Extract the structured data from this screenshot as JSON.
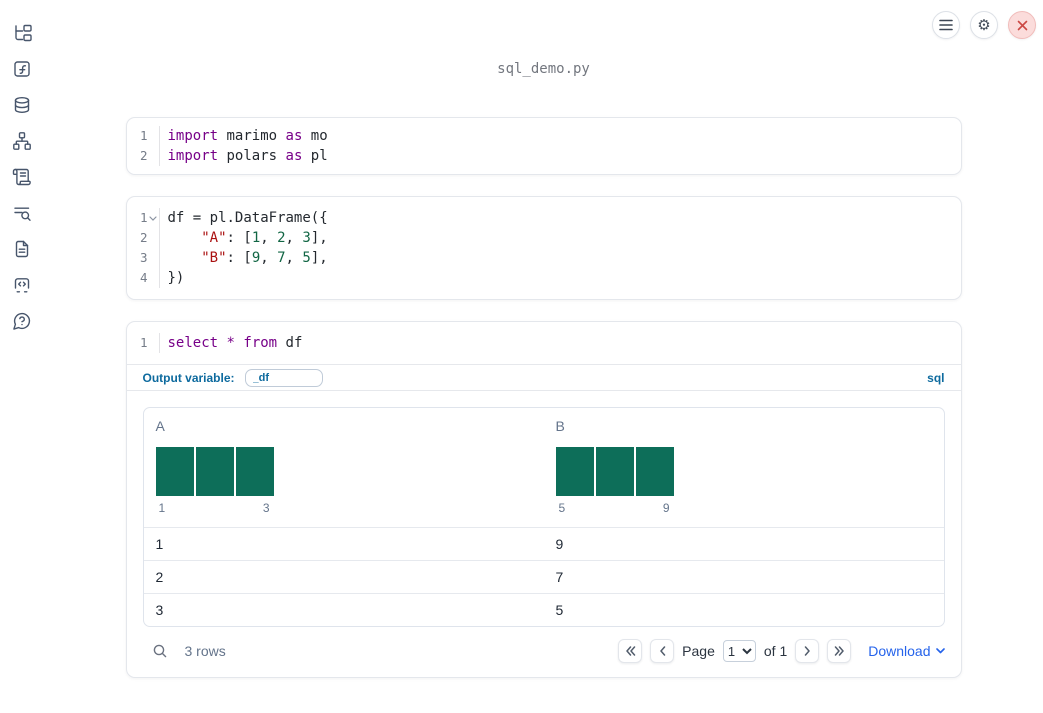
{
  "title": "sql_demo.py",
  "topbar": {
    "buttons": [
      {
        "name": "menu",
        "icon": "hamburger-icon"
      },
      {
        "name": "settings",
        "icon": "gear-icon"
      },
      {
        "name": "close",
        "icon": "close-x-icon"
      }
    ]
  },
  "sidebar": {
    "items": [
      {
        "name": "file-explorer",
        "icon": "file-tree"
      },
      {
        "name": "variables",
        "icon": "function-square"
      },
      {
        "name": "datasources",
        "icon": "database"
      },
      {
        "name": "dependencies",
        "icon": "network-graph"
      },
      {
        "name": "logs",
        "icon": "scroll"
      },
      {
        "name": "search-logs",
        "icon": "list-search"
      },
      {
        "name": "documentation",
        "icon": "file-text"
      },
      {
        "name": "snippets",
        "icon": "code-box"
      },
      {
        "name": "help",
        "icon": "help-bubble"
      }
    ]
  },
  "cells": [
    {
      "type": "python",
      "lines": [
        {
          "num": "1",
          "tokens": [
            [
              "import",
              "kw"
            ],
            [
              " marimo ",
              "pl"
            ],
            [
              "as",
              "kw"
            ],
            [
              " mo",
              "pl"
            ]
          ]
        },
        {
          "num": "2",
          "tokens": [
            [
              "import",
              "kw"
            ],
            [
              " polars ",
              "pl"
            ],
            [
              "as",
              "kw"
            ],
            [
              " pl",
              "pl"
            ]
          ]
        }
      ]
    },
    {
      "type": "python",
      "lines": [
        {
          "num": "1",
          "fold": true,
          "tokens": [
            [
              "df = pl.DataFrame({",
              "pl"
            ]
          ]
        },
        {
          "num": "2",
          "tokens": [
            [
              "    ",
              "pl"
            ],
            [
              "\"A\"",
              "str"
            ],
            [
              ": [",
              "pl"
            ],
            [
              "1",
              "num"
            ],
            [
              ", ",
              "pl"
            ],
            [
              "2",
              "num"
            ],
            [
              ", ",
              "pl"
            ],
            [
              "3",
              "num"
            ],
            [
              "],",
              "pl"
            ]
          ]
        },
        {
          "num": "3",
          "tokens": [
            [
              "    ",
              "pl"
            ],
            [
              "\"B\"",
              "str"
            ],
            [
              ": [",
              "pl"
            ],
            [
              "9",
              "num"
            ],
            [
              ", ",
              "pl"
            ],
            [
              "7",
              "num"
            ],
            [
              ", ",
              "pl"
            ],
            [
              "5",
              "num"
            ],
            [
              "],",
              "pl"
            ]
          ]
        },
        {
          "num": "4",
          "tokens": [
            [
              "})",
              "pl"
            ]
          ]
        }
      ]
    },
    {
      "type": "sql",
      "lines": [
        {
          "num": "1",
          "tokens": [
            [
              "select",
              "kw"
            ],
            [
              " ",
              "pl"
            ],
            [
              "*",
              "kw"
            ],
            [
              " ",
              "pl"
            ],
            [
              "from",
              "kw"
            ],
            [
              " df",
              "pl"
            ]
          ]
        }
      ],
      "output_variable_label": "Output variable:",
      "output_variable_value": "_df",
      "language_label": "sql"
    }
  ],
  "table": {
    "columns": [
      {
        "name": "A",
        "hist": {
          "bars": [
            1,
            1,
            1
          ],
          "min_label": "1",
          "max_label": "3"
        }
      },
      {
        "name": "B",
        "hist": {
          "bars": [
            1,
            1,
            1
          ],
          "min_label": "5",
          "max_label": "9"
        }
      }
    ],
    "rows": [
      [
        "1",
        "9"
      ],
      [
        "2",
        "7"
      ],
      [
        "3",
        "5"
      ]
    ],
    "footer": {
      "row_count": "3 rows",
      "page_label": "Page",
      "page_value": "1",
      "of_label": "of 1",
      "download_label": "Download"
    }
  },
  "colors": {
    "accent_blue": "#0d6a9e",
    "link_blue": "#2563eb",
    "hist_bar": "#0d6e59",
    "keyword": "#770088",
    "string": "#aa1111",
    "number": "#116644"
  }
}
